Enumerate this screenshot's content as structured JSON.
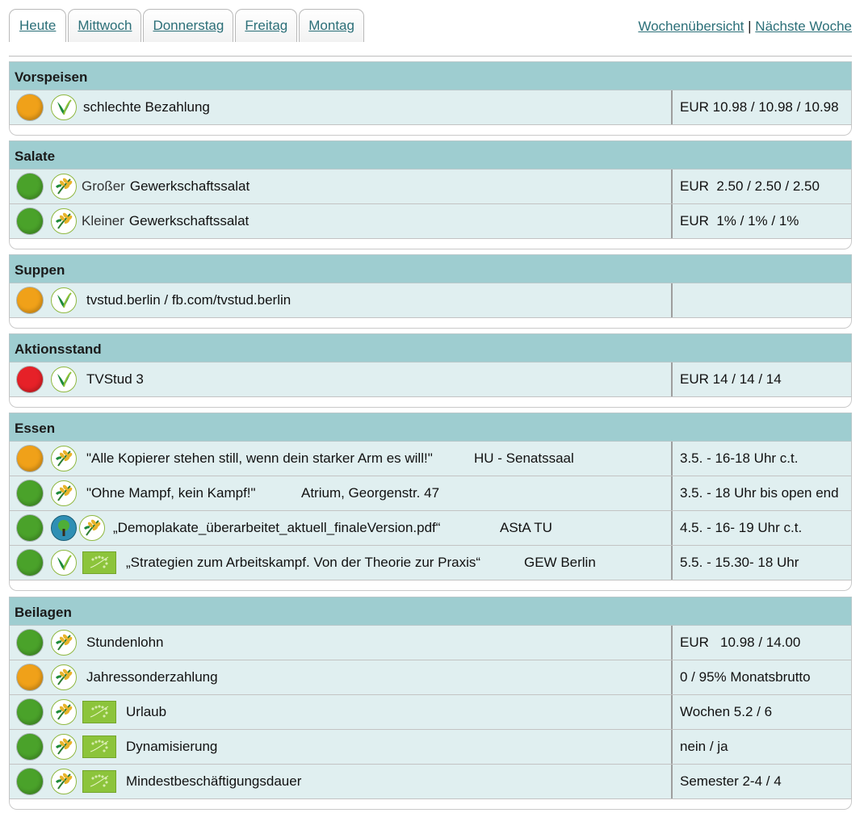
{
  "nav": {
    "tabs": [
      "Heute",
      "Mittwoch",
      "Donnerstag",
      "Freitag",
      "Montag"
    ],
    "links": {
      "week_overview": "Wochenübersicht",
      "separator": "|",
      "next_week": "Nächste Woche"
    }
  },
  "sections": [
    {
      "title": "Vorspeisen",
      "rows": [
        {
          "dot": "orange",
          "icons": [
            "vegan-icon"
          ],
          "name": "schlechte Bezahlung",
          "price": "EUR 10.98 / 10.98 / 10.98"
        }
      ]
    },
    {
      "title": "Salate",
      "rows": [
        {
          "dot": "green",
          "icons": [
            "vegetarian-icon"
          ],
          "prefix": "Großer",
          "name": "Gewerkschaftssalat",
          "price": "EUR  2.50 / 2.50 / 2.50"
        },
        {
          "dot": "green",
          "icons": [
            "vegetarian-icon"
          ],
          "prefix": "Kleiner",
          "name": "Gewerkschaftssalat",
          "price": "EUR  1% / 1% / 1%"
        }
      ]
    },
    {
      "title": "Suppen",
      "rows": [
        {
          "dot": "orange",
          "icons": [
            "vegan-icon"
          ],
          "name": "tvstud.berlin / fb.com/tvstud.berlin",
          "price": ""
        }
      ]
    },
    {
      "title": "Aktionsstand",
      "rows": [
        {
          "dot": "red",
          "icons": [
            "vegan-icon"
          ],
          "name": "TVStud 3",
          "price": "EUR 14 / 14 / 14"
        }
      ]
    },
    {
      "title": "Essen",
      "rows": [
        {
          "dot": "orange",
          "icons": [
            "vegetarian-icon"
          ],
          "name": "\"Alle Kopierer stehen still, wenn dein starker Arm es will!\"",
          "place": "HU - Senatssaal",
          "price": "3.5. - 16-18 Uhr c.t."
        },
        {
          "dot": "green",
          "icons": [
            "vegetarian-icon"
          ],
          "name": "\"Ohne Mampf, kein Kampf!\"",
          "place": "Atrium, Georgenstr. 47",
          "price": "3.5. - 18 Uhr bis open end"
        },
        {
          "dot": "green",
          "icons": [
            "sustainable-tree-icon",
            "vegetarian-icon"
          ],
          "name": "„Demoplakate_überarbeitet_aktuell_finaleVersion.pdf“",
          "place": "AStA TU",
          "price": "4.5. - 16- 19 Uhr c.t."
        },
        {
          "dot": "green",
          "icons": [
            "vegan-icon",
            "eu-organic-icon"
          ],
          "name": "„Strategien zum Arbeitskampf. Von der Theorie zur Praxis“",
          "place": "GEW Berlin",
          "price": "5.5. - 15.30- 18 Uhr"
        }
      ]
    },
    {
      "title": "Beilagen",
      "rows": [
        {
          "dot": "green",
          "icons": [
            "vegetarian-icon"
          ],
          "name": "Stundenlohn",
          "price": "EUR   10.98 / 14.00"
        },
        {
          "dot": "orange",
          "icons": [
            "vegetarian-icon"
          ],
          "name": "Jahressonderzahlung",
          "price": "0 / 95% Monatsbrutto"
        },
        {
          "dot": "green",
          "icons": [
            "vegetarian-icon",
            "eu-organic-icon"
          ],
          "name": "Urlaub",
          "price": "Wochen 5.2 / 6"
        },
        {
          "dot": "green",
          "icons": [
            "vegetarian-icon",
            "eu-organic-icon"
          ],
          "name": "Dynamisierung",
          "price": "nein / ja"
        },
        {
          "dot": "green",
          "icons": [
            "vegetarian-icon",
            "eu-organic-icon"
          ],
          "name": "Mindestbeschäftigungsdauer",
          "price": "Semester 2-4 / 4"
        }
      ]
    }
  ],
  "colors": {
    "header_bg": "#9ecdd0",
    "row_bg": "#e0eff0",
    "link": "#2b6f78",
    "dot_green": "#4aa22a",
    "dot_orange": "#f0a119",
    "dot_red": "#e62128"
  }
}
